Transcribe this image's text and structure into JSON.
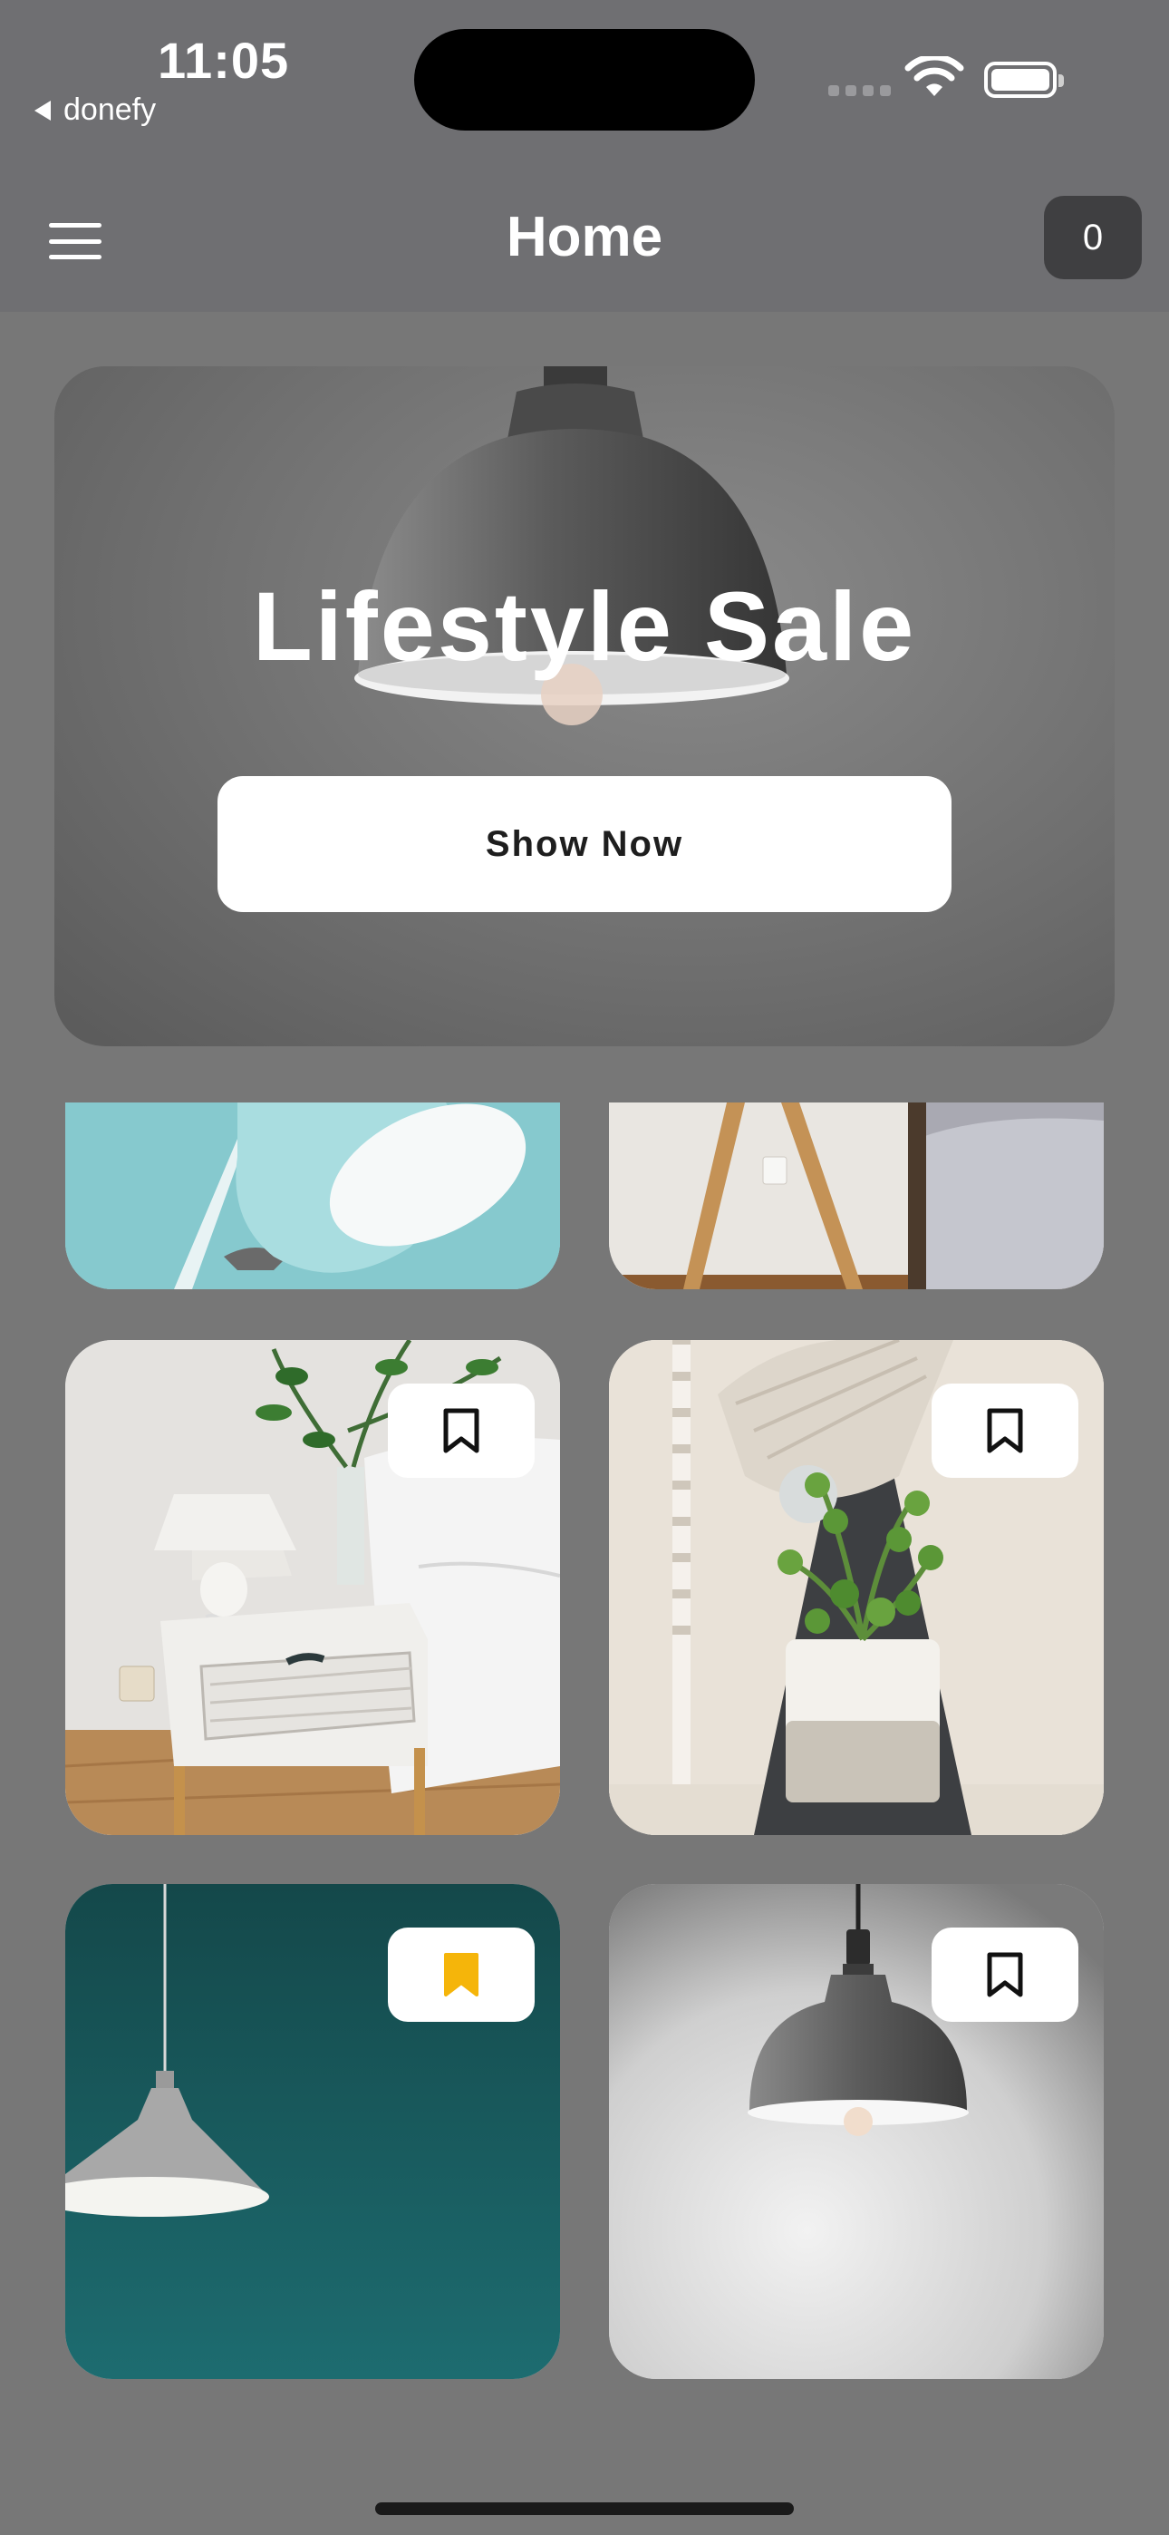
{
  "status_bar": {
    "time": "11:05",
    "back_app_label": "donefy",
    "icons": [
      "cellular-signal-icon",
      "wifi-icon",
      "battery-icon"
    ]
  },
  "nav": {
    "title": "Home",
    "menu_icon": "hamburger-menu-icon",
    "cart_count": "0"
  },
  "hero": {
    "title": "Lifestyle Sale",
    "button_label": "Show Now"
  },
  "products": [
    {
      "image": "teal-desk-lamp",
      "bookmarked": false,
      "partially_visible": true
    },
    {
      "image": "wooden-tripod-lamp-bedroom",
      "bookmarked": false,
      "partially_visible": true
    },
    {
      "image": "white-nightstand-with-lamp",
      "bookmarked": false
    },
    {
      "image": "beige-lamp-with-plant",
      "bookmarked": false
    },
    {
      "image": "grey-pendant-on-teal-wall",
      "bookmarked": true
    },
    {
      "image": "dark-pendant-lamp",
      "bookmarked": false
    }
  ],
  "colors": {
    "background": "#777777",
    "bookmark_active": "#F5B50A",
    "bookmark_inactive": "#111111"
  }
}
